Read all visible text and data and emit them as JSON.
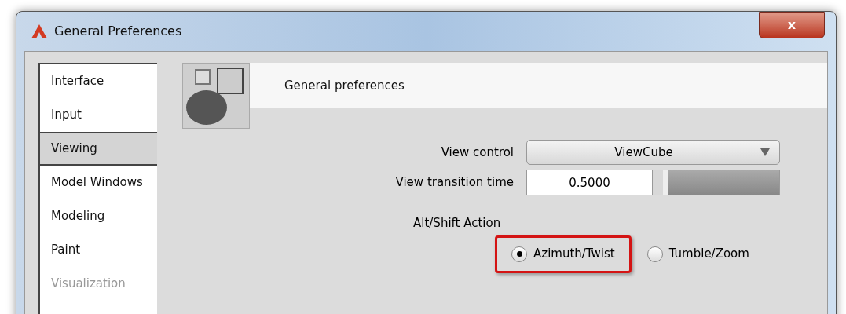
{
  "window": {
    "title": "General Preferences",
    "close": "x"
  },
  "sidebar": {
    "items": [
      {
        "label": "Interface",
        "selected": false,
        "disabled": false
      },
      {
        "label": "Input",
        "selected": false,
        "disabled": false
      },
      {
        "label": "Viewing",
        "selected": true,
        "disabled": false
      },
      {
        "label": "Model Windows",
        "selected": false,
        "disabled": false
      },
      {
        "label": "Modeling",
        "selected": false,
        "disabled": false
      },
      {
        "label": "Paint",
        "selected": false,
        "disabled": false
      },
      {
        "label": "Visualization",
        "selected": false,
        "disabled": true
      }
    ]
  },
  "header": {
    "title": "General preferences"
  },
  "view_control": {
    "label": "View control",
    "value": "ViewCube"
  },
  "view_transition_time": {
    "label": "View transition time",
    "value": "0.5000",
    "level": 0.12
  },
  "alt_shift_action": {
    "label": "Alt/Shift Action",
    "options": [
      {
        "label": "Azimuth/Twist",
        "selected": true,
        "highlighted": true
      },
      {
        "label": "Tumble/Zoom",
        "selected": false,
        "highlighted": false
      }
    ]
  }
}
